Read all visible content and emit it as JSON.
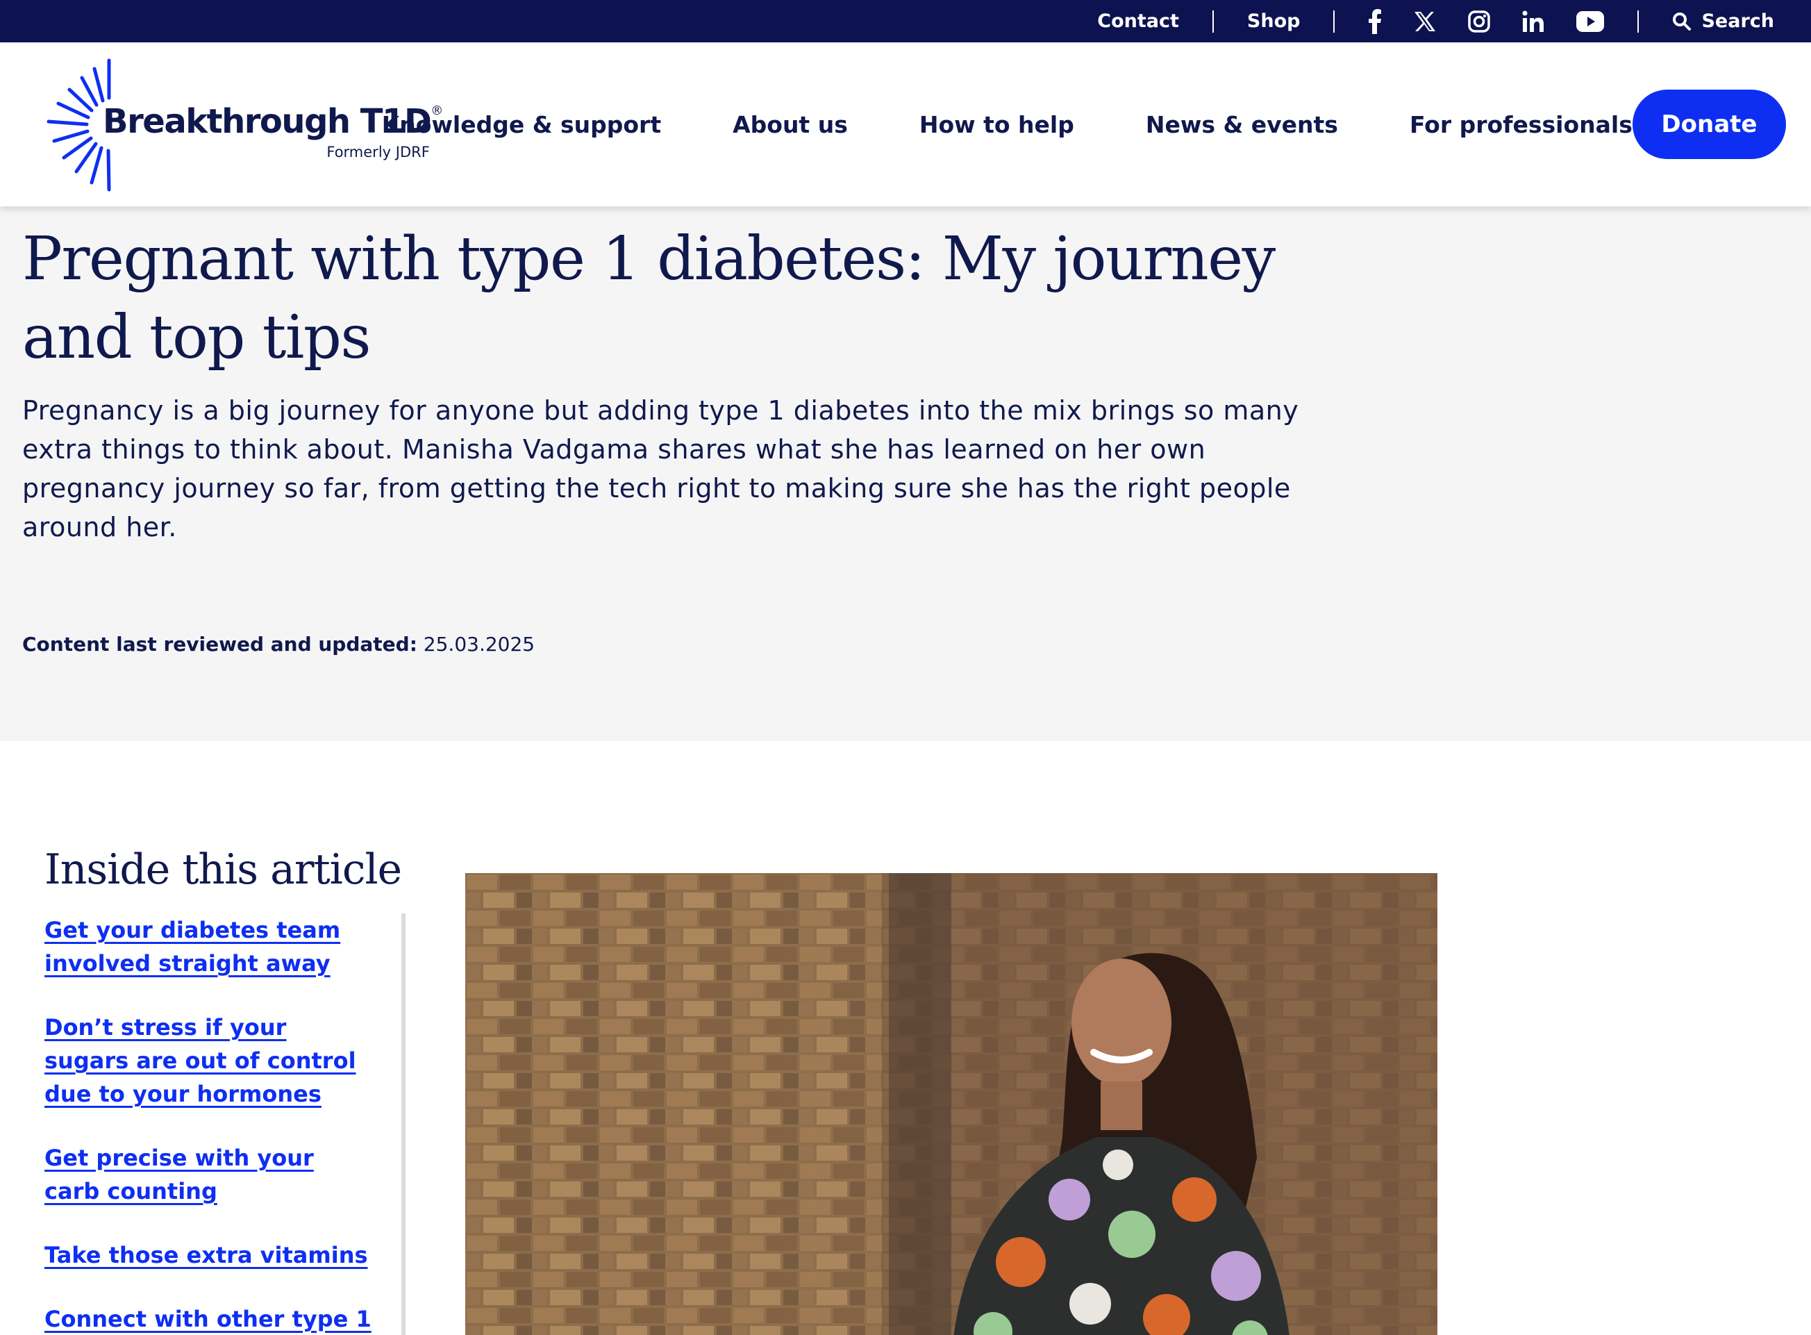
{
  "utility": {
    "contact": "Contact",
    "shop": "Shop",
    "social_icons": [
      "facebook-icon",
      "x-icon",
      "instagram-icon",
      "linkedin-icon",
      "youtube-icon"
    ],
    "search": "Search"
  },
  "brand": {
    "name": "Breakthrough T1D",
    "registered": "®",
    "formerly": "Formerly JDRF",
    "brand_color": "#0e2ff1",
    "navy": "#0d1250"
  },
  "nav": {
    "items": [
      "Knowledge & support",
      "About us",
      "How to help",
      "News & events",
      "For professionals"
    ],
    "donate": "Donate"
  },
  "article": {
    "title": "Pregnant with type 1 diabetes: My journey and top tips",
    "intro": "Pregnancy is a big journey for anyone but adding type 1 diabetes into the mix brings so many extra things to think about. Manisha Vadgama shares what she has learned on her own pregnancy journey so far, from getting the tech right to making sure she has the right people around her.",
    "reviewed_label": "Content last reviewed and updated:",
    "reviewed_date": "25.03.2025"
  },
  "toc": {
    "heading": "Inside this article",
    "links": [
      "Get your diabetes team involved straight away",
      "Don’t stress if your sugars are out of control due to your hormones",
      "Get precise with your carb counting",
      "Take those extra vitamins",
      "Connect with other type 1"
    ]
  }
}
